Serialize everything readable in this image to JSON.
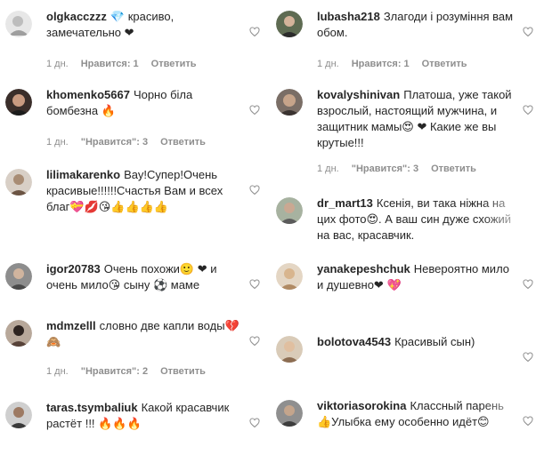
{
  "colors": {
    "text": "#262626",
    "meta": "#8e8e8e",
    "heart_outline": "#8e8e8e",
    "emoji_red": "#ed1c3c",
    "emoji_yellow": "#f8c33a",
    "emoji_orange": "#f27c22",
    "emoji_blue": "#3fb0e8"
  },
  "left": [
    {
      "username": "olgkacczzz",
      "text": "💎 красиво, замечательно ❤",
      "time": "1 дн.",
      "likes": "Нравится: 1",
      "reply": "Ответить"
    },
    {
      "username": "khomenko5667",
      "text": "Чорно біла бомбезна 🔥",
      "time": "1 дн.",
      "likes": "\"Нравится\": 3",
      "reply": "Ответить"
    },
    {
      "username": "lilimakarenko",
      "text": "Вау!Супер!Очень красивые!!!!!!Счастья Вам и всех благ💝💋😘👍👍👍👍",
      "time": "",
      "likes": "",
      "reply": ""
    },
    {
      "username": "igor20783",
      "text": "Очень похожи🙂 ❤ и очень мило😘 сыну ⚽ маме",
      "time": "",
      "likes": "",
      "reply": ""
    },
    {
      "username": "mdmzelll",
      "text": "словно две капли воды💔🙈",
      "time": "1 дн.",
      "likes": "\"Нравится\": 2",
      "reply": "Ответить"
    },
    {
      "username": "taras.tsymbaliuk",
      "text": "Какой красавчик растёт !!! 🔥🔥🔥",
      "time": "",
      "likes": "",
      "reply": ""
    }
  ],
  "right": [
    {
      "username": "lubasha218",
      "text": "Злагоди і розуміння вам обом.",
      "time": "1 дн.",
      "likes": "Нравится: 1",
      "reply": "Ответить"
    },
    {
      "username": "kovalyshinivan",
      "text": "Платоша, уже такой взрослый, настоящий мужчина, и защитник мамы😍 ❤ Какие же вы крутые!!!",
      "time": "1 дн.",
      "likes": "\"Нравится\": 3",
      "reply": "Ответить"
    },
    {
      "username": "dr_mart13",
      "text": "Ксенія, ви така ніжна на цих фото😍. А ваш син дуже схожий на вас, красавчик.",
      "time": "",
      "likes": "",
      "reply": ""
    },
    {
      "username": "yanakepeshchuk",
      "text": "Невероятно мило и душевно❤ 💖",
      "time": "",
      "likes": "",
      "reply": ""
    },
    {
      "username": "bolotova4543",
      "text": "Красивый сын)",
      "time": "",
      "likes": "",
      "reply": ""
    },
    {
      "username": "viktoriasorokina",
      "text": "Классный парень👍Улыбка ему особенно идёт😊",
      "time": "",
      "likes": "",
      "reply": ""
    }
  ]
}
